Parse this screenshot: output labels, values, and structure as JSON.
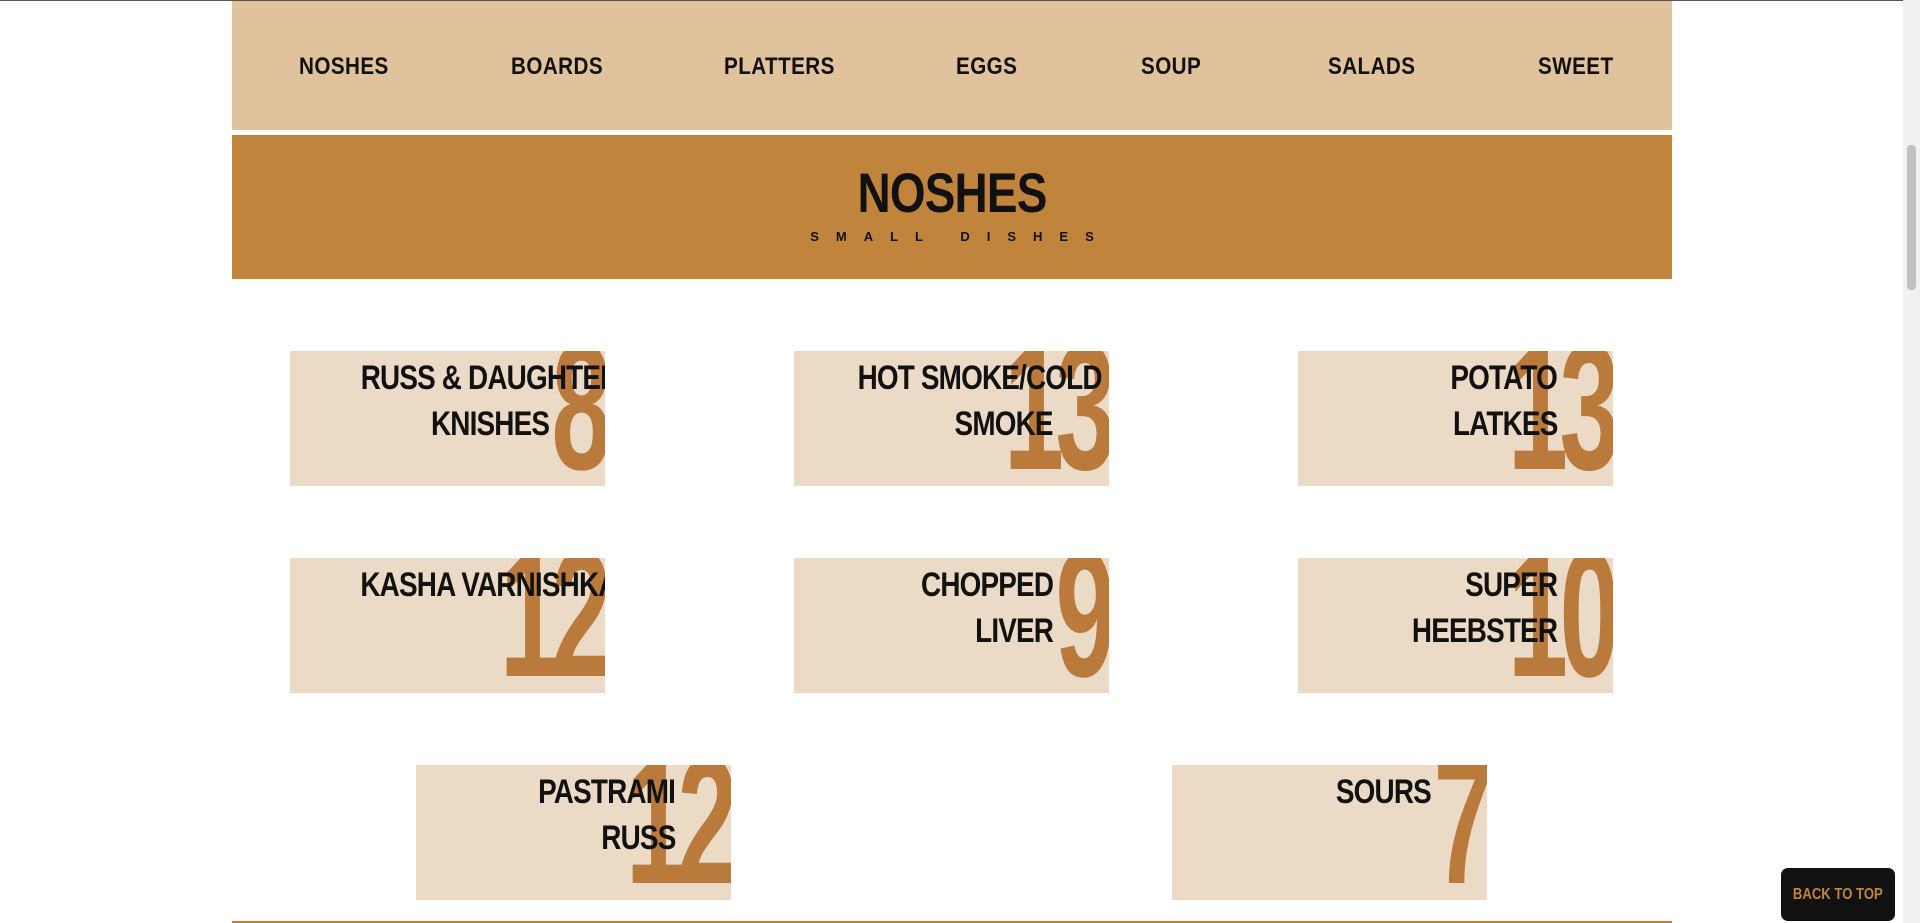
{
  "nav": {
    "items": [
      "NOSHES",
      "BOARDS",
      "PLATTERS",
      "EGGS",
      "SOUP",
      "SALADS",
      "SWEET"
    ]
  },
  "section": {
    "title": "NOSHES",
    "subtitle": "SMALL DISHES"
  },
  "menu_items": [
    {
      "name_line1": "RUSS & DAUGHTERS",
      "name_line2": "KNISHES",
      "price": "8"
    },
    {
      "name_line1": "HOT SMOKE/COLD",
      "name_line2": "SMOKE",
      "price": "13"
    },
    {
      "name_line1": "POTATO",
      "name_line2": "LATKES",
      "price": "13"
    },
    {
      "name_line1": "KASHA VARNISHKAS",
      "name_line2": "",
      "price": "12"
    },
    {
      "name_line1": "CHOPPED",
      "name_line2": "LIVER",
      "price": "9"
    },
    {
      "name_line1": "SUPER",
      "name_line2": "HEEBSTER",
      "price": "10"
    },
    {
      "name_line1": "PASTRAMI",
      "name_line2": "RUSS",
      "price": "12"
    },
    {
      "name_line1": "SOURS",
      "name_line2": "",
      "price": "7"
    }
  ],
  "back_to_top": {
    "label": "BACK TO TOP"
  },
  "colors": {
    "nav_bg": "#e0c29d",
    "header_bg": "#c0843c",
    "card_bg": "#ebdac5",
    "price_color": "#b97a3c",
    "button_bg": "#111111",
    "button_text": "#c0843c"
  }
}
